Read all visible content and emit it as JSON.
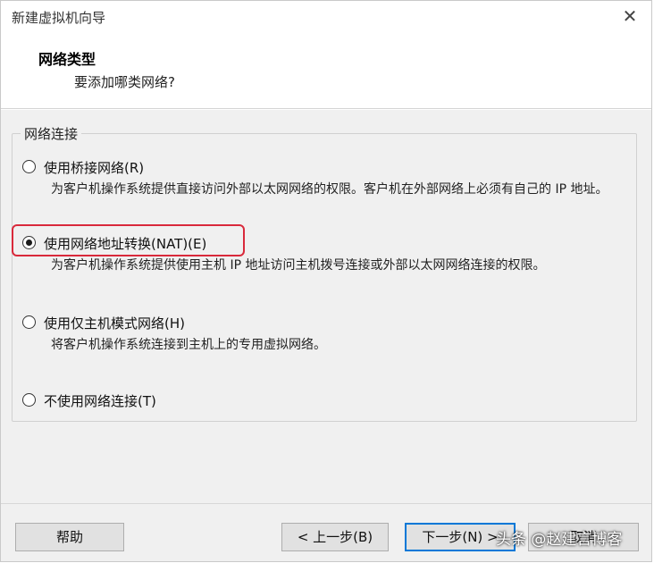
{
  "window": {
    "title": "新建虚拟机向导",
    "close_label": "✕"
  },
  "header": {
    "title": "网络类型",
    "subtitle": "要添加哪类网络?"
  },
  "group": {
    "legend": "网络连接",
    "options": [
      {
        "label": "使用桥接网络(R)",
        "description": "为客户机操作系统提供直接访问外部以太网网络的权限。客户机在外部网络上必须有自己的 IP 地址。",
        "selected": false
      },
      {
        "label": "使用网络地址转换(NAT)(E)",
        "description": "为客户机操作系统提供使用主机 IP 地址访问主机拨号连接或外部以太网网络连接的权限。",
        "selected": true
      },
      {
        "label": "使用仅主机模式网络(H)",
        "description": "将客户机操作系统连接到主机上的专用虚拟网络。",
        "selected": false
      },
      {
        "label": "不使用网络连接(T)",
        "description": "",
        "selected": false
      }
    ]
  },
  "footer": {
    "help": "帮助",
    "back": "< 上一步(B)",
    "next": "下一步(N) >",
    "cancel": "取消"
  },
  "watermark": "头条 @赵建言博客",
  "colors": {
    "highlight": "#d9293b",
    "default_button_border": "#0078d7"
  }
}
